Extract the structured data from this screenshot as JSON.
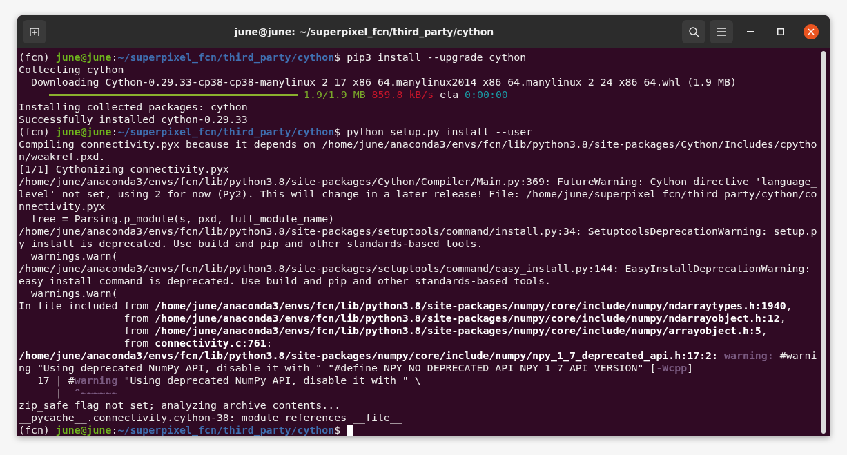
{
  "window": {
    "title": "june@june: ~/superpixel_fcn/third_party/cython"
  },
  "terminal": {
    "lines": [
      [
        {
          "kind": "plain",
          "text": "(fcn) "
        },
        {
          "kind": "user",
          "text": "june@june"
        },
        {
          "kind": "plain",
          "text": ":"
        },
        {
          "kind": "path",
          "text": "~/superpixel_fcn/third_party/cython"
        },
        {
          "kind": "plain",
          "text": "$ pip3 install --upgrade cython"
        }
      ],
      [
        {
          "kind": "plain",
          "text": "Collecting cython"
        }
      ],
      [
        {
          "kind": "plain",
          "text": "  Downloading Cython-0.29.33-cp38-cp38-manylinux_2_17_x86_64.manylinux2014_x86_64.manylinux_2_24_x86_64.whl (1.9 MB)"
        }
      ],
      [
        {
          "kind": "bar",
          "level": 1
        },
        {
          "kind": "ok",
          "text": " 1.9/1.9 MB"
        },
        {
          "kind": "speed",
          "text": " 859.8 kB/s"
        },
        {
          "kind": "plain",
          "text": " eta "
        },
        {
          "kind": "eta",
          "text": "0:00:00"
        }
      ],
      [
        {
          "kind": "plain",
          "text": "Installing collected packages: cython"
        }
      ],
      [
        {
          "kind": "plain",
          "text": "Successfully installed cython-0.29.33"
        }
      ],
      [
        {
          "kind": "plain",
          "text": "(fcn) "
        },
        {
          "kind": "user",
          "text": "june@june"
        },
        {
          "kind": "plain",
          "text": ":"
        },
        {
          "kind": "path",
          "text": "~/superpixel_fcn/third_party/cython"
        },
        {
          "kind": "plain",
          "text": "$ python setup.py install --user"
        }
      ],
      [
        {
          "kind": "plain",
          "text": "Compiling connectivity.pyx because it depends on /home/june/anaconda3/envs/fcn/lib/python3.8/site-packages/Cython/Includes/cpytho"
        }
      ],
      [
        {
          "kind": "plain",
          "text": "n/weakref.pxd."
        }
      ],
      [
        {
          "kind": "plain",
          "text": "[1/1] Cythonizing connectivity.pyx"
        }
      ],
      [
        {
          "kind": "plain",
          "text": "/home/june/anaconda3/envs/fcn/lib/python3.8/site-packages/Cython/Compiler/Main.py:369: FutureWarning: Cython directive 'language_"
        }
      ],
      [
        {
          "kind": "plain",
          "text": "level' not set, using 2 for now (Py2). This will change in a later release! File: /home/june/superpixel_fcn/third_party/cython/co"
        }
      ],
      [
        {
          "kind": "plain",
          "text": "nnectivity.pyx"
        }
      ],
      [
        {
          "kind": "plain",
          "text": "  tree = Parsing.p_module(s, pxd, full_module_name)"
        }
      ],
      [
        {
          "kind": "plain",
          "text": "/home/june/anaconda3/envs/fcn/lib/python3.8/site-packages/setuptools/command/install.py:34: SetuptoolsDeprecationWarning: setup.p"
        }
      ],
      [
        {
          "kind": "plain",
          "text": "y install is deprecated. Use build and pip and other standards-based tools."
        }
      ],
      [
        {
          "kind": "plain",
          "text": "  warnings.warn("
        }
      ],
      [
        {
          "kind": "plain",
          "text": "/home/june/anaconda3/envs/fcn/lib/python3.8/site-packages/setuptools/command/easy_install.py:144: EasyInstallDeprecationWarning:"
        }
      ],
      [
        {
          "kind": "plain",
          "text": "easy_install command is deprecated. Use build and pip and other standards-based tools."
        }
      ],
      [
        {
          "kind": "plain",
          "text": "  warnings.warn("
        }
      ],
      [
        {
          "kind": "plain",
          "text": "In file included from "
        },
        {
          "kind": "bold",
          "text": "/home/june/anaconda3/envs/fcn/lib/python3.8/site-packages/numpy/core/include/numpy/ndarraytypes.h:1940"
        },
        {
          "kind": "plain",
          "text": ","
        }
      ],
      [
        {
          "kind": "plain",
          "text": "                 from "
        },
        {
          "kind": "bold",
          "text": "/home/june/anaconda3/envs/fcn/lib/python3.8/site-packages/numpy/core/include/numpy/ndarrayobject.h:12"
        },
        {
          "kind": "plain",
          "text": ","
        }
      ],
      [
        {
          "kind": "plain",
          "text": "                 from "
        },
        {
          "kind": "bold",
          "text": "/home/june/anaconda3/envs/fcn/lib/python3.8/site-packages/numpy/core/include/numpy/arrayobject.h:5"
        },
        {
          "kind": "plain",
          "text": ","
        }
      ],
      [
        {
          "kind": "plain",
          "text": "                 from "
        },
        {
          "kind": "bold",
          "text": "connectivity.c:761"
        },
        {
          "kind": "plain",
          "text": ":"
        }
      ],
      [
        {
          "kind": "bold",
          "text": "/home/june/anaconda3/envs/fcn/lib/python3.8/site-packages/numpy/core/include/numpy/npy_1_7_deprecated_api.h:17:2: "
        },
        {
          "kind": "warn",
          "text": "warning:"
        },
        {
          "kind": "plain",
          "text": " #warni"
        }
      ],
      [
        {
          "kind": "plain",
          "text": "ng \"Using deprecated NumPy API, disable it with \" \"#define NPY_NO_DEPRECATED_API NPY_1_7_API_VERSION\" ["
        },
        {
          "kind": "warn",
          "text": "-Wcpp"
        },
        {
          "kind": "plain",
          "text": "]"
        }
      ],
      [
        {
          "kind": "plain",
          "text": "   17 | #"
        },
        {
          "kind": "warn",
          "text": "warning"
        },
        {
          "kind": "plain",
          "text": " \"Using deprecated NumPy API, disable it with \" \\"
        }
      ],
      [
        {
          "kind": "plain",
          "text": "      |  "
        },
        {
          "kind": "warn",
          "text": "^~~~~~~"
        }
      ],
      [
        {
          "kind": "plain",
          "text": "zip_safe flag not set; analyzing archive contents..."
        }
      ],
      [
        {
          "kind": "plain",
          "text": "__pycache__.connectivity.cython-38: module references __file__"
        }
      ],
      [
        {
          "kind": "plain",
          "text": "(fcn) "
        },
        {
          "kind": "user",
          "text": "june@june"
        },
        {
          "kind": "plain",
          "text": ":"
        },
        {
          "kind": "path",
          "text": "~/superpixel_fcn/third_party/cython"
        },
        {
          "kind": "plain",
          "text": "$ "
        },
        {
          "kind": "cursor"
        }
      ]
    ]
  }
}
